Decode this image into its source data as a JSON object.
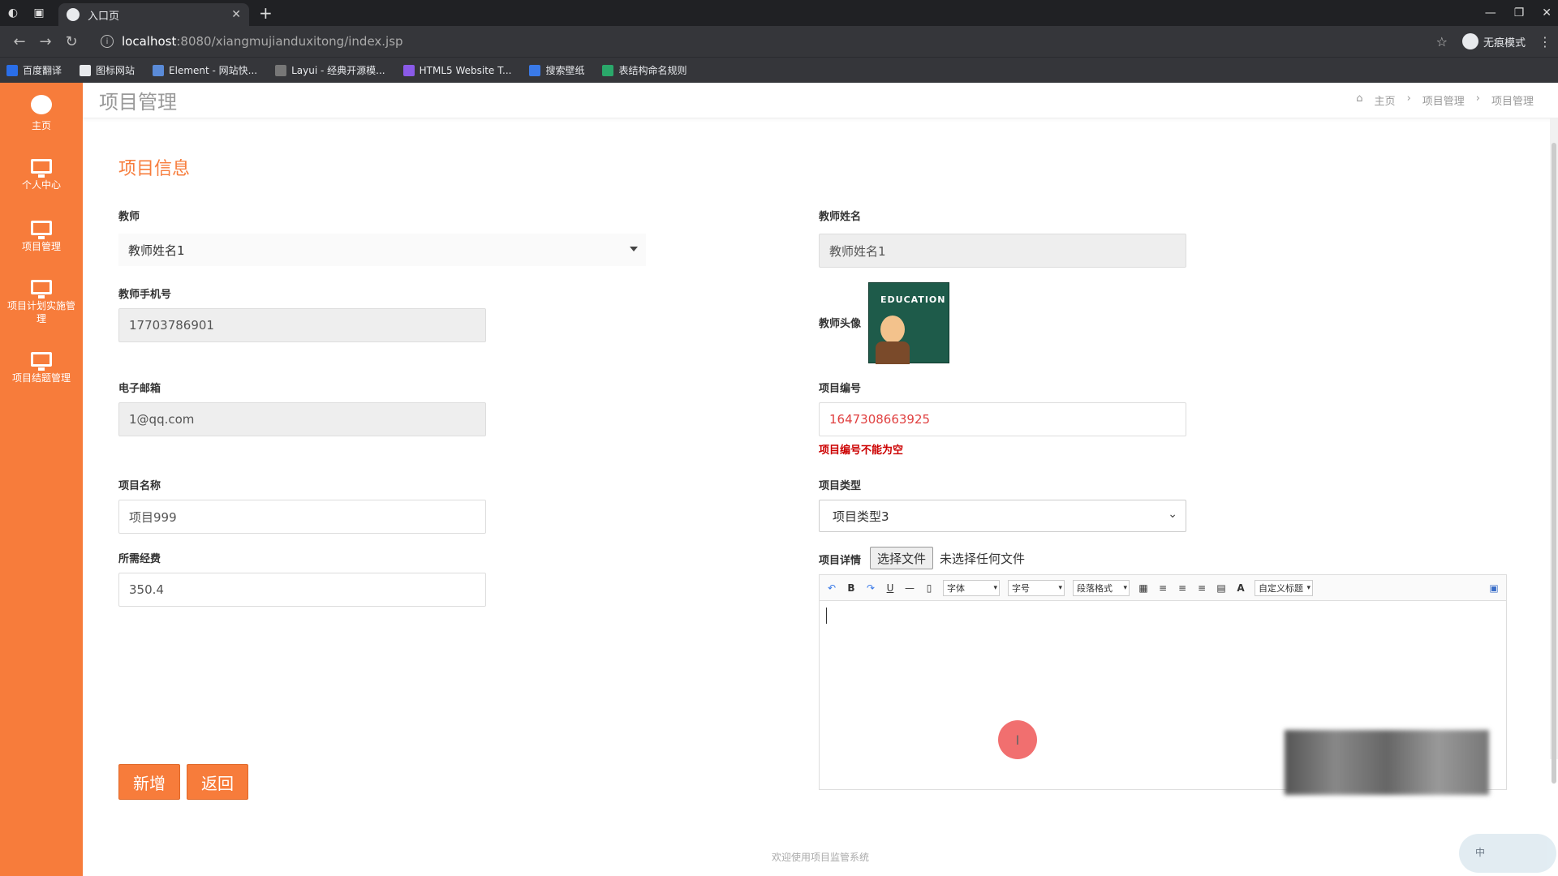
{
  "browser": {
    "tab_title": "入口页",
    "url_host": "localhost",
    "url_path": ":8080/xiangmujianduxitong/index.jsp",
    "incognito_label": "无痕模式",
    "bookmarks": [
      "百度翻译",
      "图标网站",
      "Element - 网站快...",
      "Layui - 经典开源模...",
      "HTML5 Website T...",
      "搜索壁纸",
      "表结构命名规则"
    ]
  },
  "sidebar": {
    "items": [
      {
        "label": "主页",
        "icon": "dashboard-icon"
      },
      {
        "label": "个人中心",
        "icon": "monitor-icon"
      },
      {
        "label": "项目管理",
        "icon": "monitor-icon"
      },
      {
        "label": "项目计划实施管理",
        "icon": "monitor-icon"
      },
      {
        "label": "项目结题管理",
        "icon": "monitor-icon"
      }
    ]
  },
  "header": {
    "title": "项目管理",
    "breadcrumb": [
      "主页",
      "项目管理",
      "项目管理"
    ]
  },
  "form": {
    "section_title": "项目信息",
    "teacher": {
      "label": "教师",
      "value": "教师姓名1"
    },
    "teacher_name": {
      "label": "教师姓名",
      "value": "教师姓名1"
    },
    "phone": {
      "label": "教师手机号",
      "value": "17703786901"
    },
    "avatar": {
      "label": "教师头像",
      "image_text": "EDUCATION"
    },
    "email": {
      "label": "电子邮箱",
      "value": "1@qq.com"
    },
    "project_no": {
      "label": "项目编号",
      "value": "1647308663925",
      "error": "项目编号不能为空"
    },
    "project_name": {
      "label": "项目名称",
      "value": "项目999"
    },
    "project_type": {
      "label": "项目类型",
      "value": "项目类型3"
    },
    "budget": {
      "label": "所需经费",
      "value": "350.4"
    },
    "details": {
      "label": "项目详情",
      "file_button": "选择文件",
      "file_status": "未选择任何文件"
    },
    "editor_toolbar": {
      "font": "字体",
      "size": "字号",
      "paragraph": "段落格式",
      "custom": "自定义标题",
      "color_letter": "A"
    }
  },
  "actions": {
    "add": "新增",
    "back": "返回"
  },
  "footer": {
    "text": "欢迎使用项目监管系统"
  },
  "ime": {
    "label": "中"
  },
  "colors": {
    "accent": "#f77c3b",
    "error": "#c00000"
  }
}
